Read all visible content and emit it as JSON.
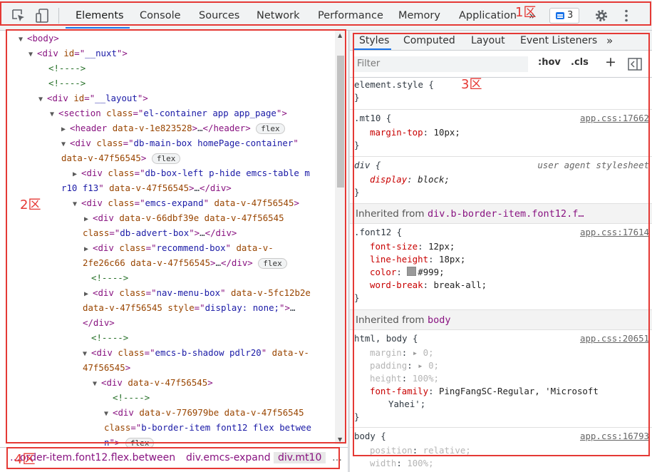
{
  "toolbar": {
    "tabs": [
      "Elements",
      "Console",
      "Sources",
      "Network",
      "Performance",
      "Memory",
      "Application"
    ],
    "more": "»",
    "issues_count": "3"
  },
  "elements": {
    "lines": [
      {
        "t": "▼",
        "p": [
          [
            "tag",
            "<body>"
          ]
        ]
      },
      {
        "t": "▼",
        "p": [
          [
            "tag",
            "<div "
          ],
          [
            "attr",
            "id"
          ],
          [
            "tag",
            "=\""
          ],
          [
            "val",
            "__nuxt"
          ],
          [
            "tag",
            "\">"
          ]
        ]
      },
      {
        "t": "",
        "p": [
          [
            "cmt",
            "<!---->"
          ]
        ]
      },
      {
        "t": "",
        "p": [
          [
            "cmt",
            "<!---->"
          ]
        ]
      },
      {
        "t": "▼",
        "p": [
          [
            "tag",
            "<div "
          ],
          [
            "attr",
            "id"
          ],
          [
            "tag",
            "=\""
          ],
          [
            "val",
            "__layout"
          ],
          [
            "tag",
            "\">"
          ]
        ]
      },
      {
        "t": "▼",
        "p": [
          [
            "tag",
            "<section "
          ],
          [
            "attr",
            "class"
          ],
          [
            "tag",
            "=\""
          ],
          [
            "val",
            "el-container app app_page"
          ],
          [
            "tag",
            "\">"
          ]
        ]
      },
      {
        "t": "▶",
        "p": [
          [
            "tag",
            "<header "
          ],
          [
            "attr",
            "data-v-1e823528"
          ],
          [
            "tag",
            ">"
          ],
          [
            "txt",
            "…"
          ],
          [
            "tag",
            "</header>"
          ]
        ],
        "badge": "flex"
      },
      {
        "t": "▼",
        "p": [
          [
            "tag",
            "<div "
          ],
          [
            "attr",
            "class"
          ],
          [
            "tag",
            "=\""
          ],
          [
            "val",
            "db-main-box homePage-container"
          ],
          [
            "tag",
            "\""
          ]
        ]
      },
      {
        "t": "",
        "p": [
          [
            "attr",
            "data-v-47f56545"
          ],
          [
            "tag",
            ">"
          ]
        ],
        "badge": "flex"
      },
      {
        "t": "▶",
        "p": [
          [
            "tag",
            "<div "
          ],
          [
            "attr",
            "class"
          ],
          [
            "tag",
            "=\""
          ],
          [
            "val",
            "db-box-left p-hide emcs-table m"
          ]
        ]
      },
      {
        "t": "",
        "p": [
          [
            "val",
            "r10 f13"
          ],
          [
            "tag",
            "\" "
          ],
          [
            "attr",
            "data-v-47f56545"
          ],
          [
            "tag",
            ">"
          ],
          [
            "txt",
            "…"
          ],
          [
            "tag",
            "</div>"
          ]
        ]
      },
      {
        "t": "▼",
        "p": [
          [
            "tag",
            "<div "
          ],
          [
            "attr",
            "class"
          ],
          [
            "tag",
            "=\""
          ],
          [
            "val",
            "emcs-expand"
          ],
          [
            "tag",
            "\" "
          ],
          [
            "attr",
            "data-v-47f56545"
          ],
          [
            "tag",
            ">"
          ]
        ]
      },
      {
        "t": "▶",
        "p": [
          [
            "tag",
            "<div "
          ],
          [
            "attr",
            "data-v-66dbf39e data-v-47f56545"
          ]
        ]
      },
      {
        "t": "",
        "p": [
          [
            "attr",
            "class"
          ],
          [
            "tag",
            "=\""
          ],
          [
            "val",
            "db-advert-box"
          ],
          [
            "tag",
            "\">"
          ],
          [
            "txt",
            "…"
          ],
          [
            "tag",
            "</div>"
          ]
        ]
      },
      {
        "t": "▶",
        "p": [
          [
            "tag",
            "<div "
          ],
          [
            "attr",
            "class"
          ],
          [
            "tag",
            "=\""
          ],
          [
            "val",
            "recommend-box"
          ],
          [
            "tag",
            "\" "
          ],
          [
            "attr",
            "data-v-"
          ]
        ]
      },
      {
        "t": "",
        "p": [
          [
            "attr",
            "2fe26c66 data-v-47f56545"
          ],
          [
            "tag",
            ">"
          ],
          [
            "txt",
            "…"
          ],
          [
            "tag",
            "</div>"
          ]
        ],
        "badge": "flex"
      },
      {
        "t": "",
        "p": [
          [
            "cmt",
            "<!---->"
          ]
        ]
      },
      {
        "t": "▶",
        "p": [
          [
            "tag",
            "<div "
          ],
          [
            "attr",
            "class"
          ],
          [
            "tag",
            "=\""
          ],
          [
            "val",
            "nav-menu-box"
          ],
          [
            "tag",
            "\" "
          ],
          [
            "attr",
            "data-v-5fc12b2e"
          ]
        ]
      },
      {
        "t": "",
        "p": [
          [
            "attr",
            "data-v-47f56545 style"
          ],
          [
            "tag",
            "=\""
          ],
          [
            "val",
            "display: none;"
          ],
          [
            "tag",
            "\">"
          ],
          [
            "txt",
            "…"
          ]
        ]
      },
      {
        "t": "",
        "p": [
          [
            "tag",
            "</div>"
          ]
        ]
      },
      {
        "t": "",
        "p": [
          [
            "cmt",
            "<!---->"
          ]
        ]
      },
      {
        "t": "▼",
        "p": [
          [
            "tag",
            "<div "
          ],
          [
            "attr",
            "class"
          ],
          [
            "tag",
            "=\""
          ],
          [
            "val",
            "emcs-b-shadow pdlr20"
          ],
          [
            "tag",
            "\" "
          ],
          [
            "attr",
            "data-v-"
          ]
        ]
      },
      {
        "t": "",
        "p": [
          [
            "attr",
            "47f56545"
          ],
          [
            "tag",
            ">"
          ]
        ]
      },
      {
        "t": "▼",
        "p": [
          [
            "tag",
            "<div "
          ],
          [
            "attr",
            "data-v-47f56545"
          ],
          [
            "tag",
            ">"
          ]
        ]
      },
      {
        "t": "",
        "p": [
          [
            "cmt",
            "<!---->"
          ]
        ]
      },
      {
        "t": "▼",
        "p": [
          [
            "tag",
            "<div "
          ],
          [
            "attr",
            "data-v-776979be data-v-47f56545"
          ]
        ]
      },
      {
        "t": "",
        "p": [
          [
            "attr",
            "class"
          ],
          [
            "tag",
            "=\""
          ],
          [
            "val",
            "b-border-item font12 flex betwee"
          ]
        ]
      },
      {
        "t": "",
        "p": [
          [
            "val",
            "n"
          ],
          [
            "tag",
            "\">"
          ]
        ],
        "badge": "flex"
      }
    ]
  },
  "breadcrumbs": [
    "…order-item.font12.flex.between",
    "div.emcs-expand",
    "div.mt10",
    "…"
  ],
  "styles": {
    "subtabs": [
      "Styles",
      "Computed",
      "Layout",
      "Event Listeners",
      "»"
    ],
    "filter_placeholder": "Filter",
    "hov": ":hov",
    "cls": ".cls",
    "plus": "+",
    "element_style": "element.style {",
    "close_brace": "}",
    "rule_mt10": {
      "selector": ".mt10 {",
      "source": "app.css:17662",
      "prop": "margin-top",
      "value": "10px;"
    },
    "rule_div": {
      "selector": "div {",
      "source": "user agent stylesheet",
      "prop": "display",
      "value": "block;"
    },
    "inherit1": {
      "label": "Inherited from",
      "from": "div.b-border-item.font12.f…"
    },
    "rule_font12": {
      "selector": ".font12 {",
      "source": "app.css:17614",
      "props": [
        [
          "font-size",
          "12px;"
        ],
        [
          "line-height",
          "18px;"
        ],
        [
          "color",
          "#999;"
        ],
        [
          "word-break",
          "break-all;"
        ]
      ]
    },
    "inherit2": {
      "label": "Inherited from",
      "from": "body"
    },
    "rule_html": {
      "selector": "html, body {",
      "source": "app.css:20651",
      "props": [
        [
          "margin",
          "0;"
        ],
        [
          "padding",
          "0;"
        ],
        [
          "height",
          "100%;"
        ],
        [
          "font-family",
          "PingFangSC-Regular, 'Microsoft"
        ]
      ],
      "cont": "Yahei';"
    },
    "rule_body": {
      "selector": "body {",
      "source": "app.css:16793",
      "props": [
        [
          "position",
          "relative;"
        ],
        [
          "width",
          "100%;"
        ]
      ]
    }
  },
  "annotations": [
    "1区",
    "2区",
    "3区",
    "4区"
  ],
  "colors": {
    "annotation": "#e53935",
    "accent": "#1a73e8"
  }
}
